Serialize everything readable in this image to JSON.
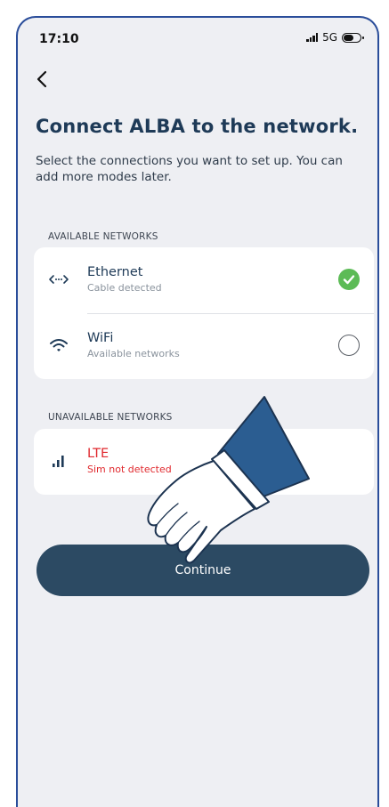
{
  "status_bar": {
    "time": "17:10",
    "network": "5G"
  },
  "page": {
    "title": "Connect ALBA to the network.",
    "subtitle": "Select the connections you want to set up. You can add more modes later."
  },
  "available": {
    "label": "AVAILABLE NETWORKS",
    "items": [
      {
        "name": "Ethernet",
        "desc": "Cable detected",
        "icon": "ethernet-icon",
        "selected": true
      },
      {
        "name": "WiFi",
        "desc": "Available networks",
        "icon": "wifi-icon",
        "selected": false
      }
    ]
  },
  "unavailable": {
    "label": "UNAVAILABLE NETWORKS",
    "items": [
      {
        "name": "LTE",
        "desc": "Sim not detected",
        "icon": "cellular-signal-icon"
      }
    ]
  },
  "buttons": {
    "continue_label": "Continue"
  },
  "colors": {
    "title": "#1e3a57",
    "button": "#2c4a63",
    "check": "#5cbb56",
    "error": "#e0292e",
    "background": "#eeeff3"
  }
}
